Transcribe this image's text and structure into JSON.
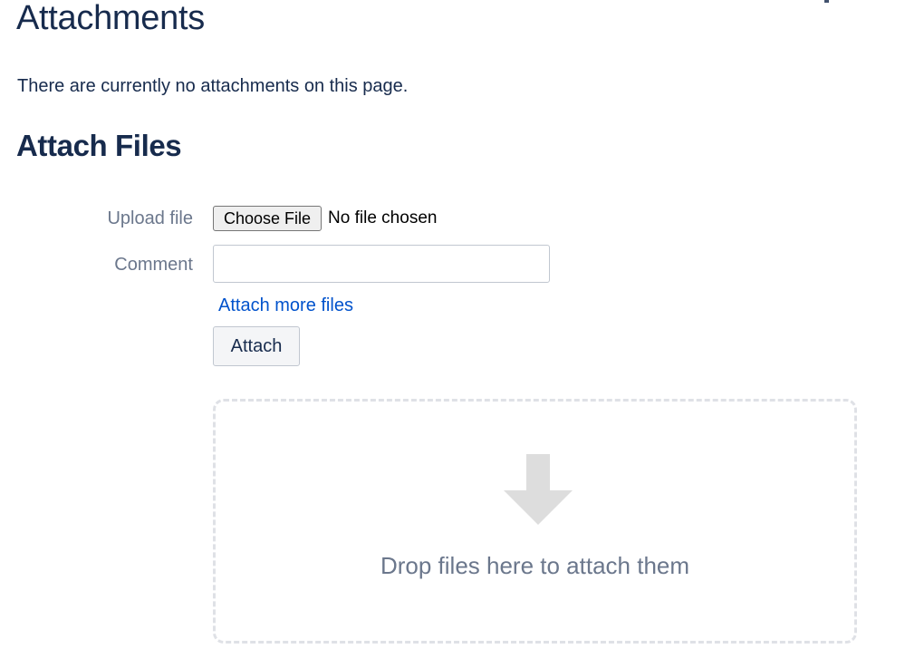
{
  "page": {
    "title": "Attachments",
    "empty_message": "There are currently no attachments on this page."
  },
  "attach_section": {
    "heading": "Attach Files",
    "upload_label": "Upload file",
    "choose_file_button": "Choose File",
    "file_status": "No file chosen",
    "comment_label": "Comment",
    "comment_value": "",
    "comment_placeholder": "",
    "attach_more_link": "Attach more files",
    "attach_button": "Attach"
  },
  "drop_zone": {
    "icon": "arrow-down-icon",
    "text": "Drop files here to attach them"
  },
  "colors": {
    "heading": "#172b4d",
    "label": "#6b778c",
    "link": "#0052cc",
    "drop_border": "#dfe1e6",
    "drop_icon": "#dddddd"
  }
}
